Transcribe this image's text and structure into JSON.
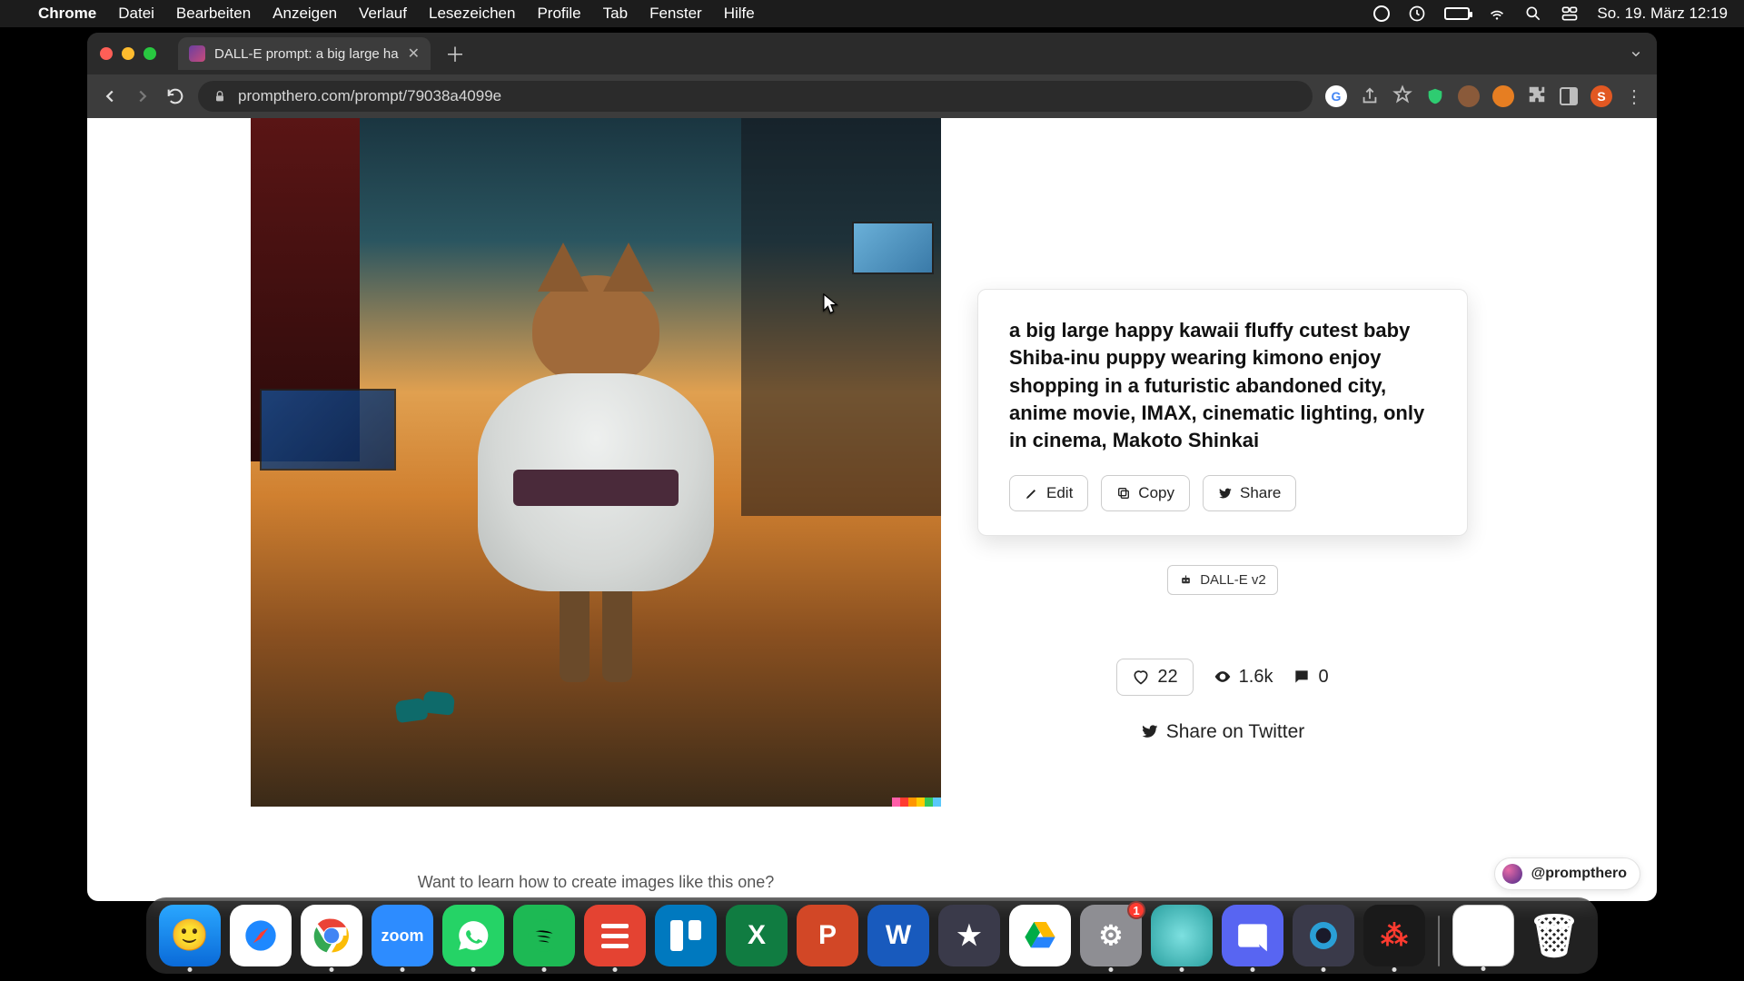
{
  "menubar": {
    "app": "Chrome",
    "items": [
      "Datei",
      "Bearbeiten",
      "Anzeigen",
      "Verlauf",
      "Lesezeichen",
      "Profile",
      "Tab",
      "Fenster",
      "Hilfe"
    ],
    "clock": "So. 19. März  12:19"
  },
  "browser": {
    "tab_title": "DALL-E prompt: a big large ha",
    "url": "prompthero.com/prompt/79038a4099e"
  },
  "page": {
    "prompt_text": "a big large happy kawaii fluffy cutest baby Shiba-inu puppy wearing kimono enjoy shopping in a futuristic abandoned city, anime movie, IMAX, cinematic lighting, only in cinema, Makoto Shinkai",
    "actions": {
      "edit": "Edit",
      "copy": "Copy",
      "share": "Share"
    },
    "model_chip": "DALL-E v2",
    "stats": {
      "likes": "22",
      "views": "1.6k",
      "comments": "0"
    },
    "share_twitter": "Share on Twitter",
    "learn_cta": "Want to learn how to create images like this one?",
    "corner_badge": "@prompthero"
  },
  "dock": {
    "settings_badge": "1"
  }
}
